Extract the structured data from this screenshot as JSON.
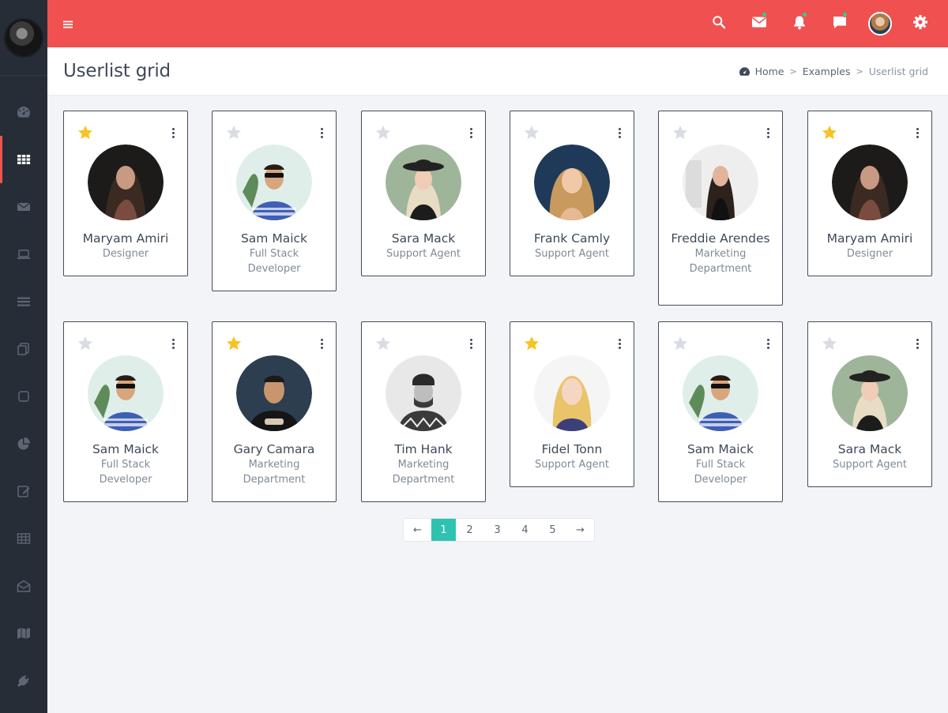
{
  "header": {
    "page_title": "Userlist grid"
  },
  "breadcrumb": {
    "home": "Home",
    "examples": "Examples",
    "current": "Userlist grid",
    "sep": ">"
  },
  "users": [
    {
      "name": "Maryam Amiri",
      "role": "Designer",
      "starred": true
    },
    {
      "name": "Sam Maick",
      "role": "Full Stack Developer",
      "starred": false
    },
    {
      "name": "Sara Mack",
      "role": "Support Agent",
      "starred": false
    },
    {
      "name": "Frank Camly",
      "role": "Support Agent",
      "starred": false
    },
    {
      "name": "Freddie Arendes",
      "role": "Marketing Department",
      "starred": false
    },
    {
      "name": "Maryam Amiri",
      "role": "Designer",
      "starred": true
    },
    {
      "name": "Sam Maick",
      "role": "Full Stack Developer",
      "starred": false
    },
    {
      "name": "Gary Camara",
      "role": "Marketing Department",
      "starred": true
    },
    {
      "name": "Tim Hank",
      "role": "Marketing Department",
      "starred": false
    },
    {
      "name": "Fidel Tonn",
      "role": "Support Agent",
      "starred": true
    },
    {
      "name": "Sam Maick",
      "role": "Full Stack Developer",
      "starred": false
    },
    {
      "name": "Sara Mack",
      "role": "Support Agent",
      "starred": false
    }
  ],
  "pagination": {
    "prev": "←",
    "pages": [
      "1",
      "2",
      "3",
      "4",
      "5"
    ],
    "active": "1",
    "next": "→"
  },
  "colors": {
    "topbar": "#f05050",
    "sidebar": "#262d37",
    "accent": "#2ec3b0",
    "star_on": "#f7c325",
    "star_off": "#d9dde3",
    "notify_dot": "#2ecc9b"
  }
}
